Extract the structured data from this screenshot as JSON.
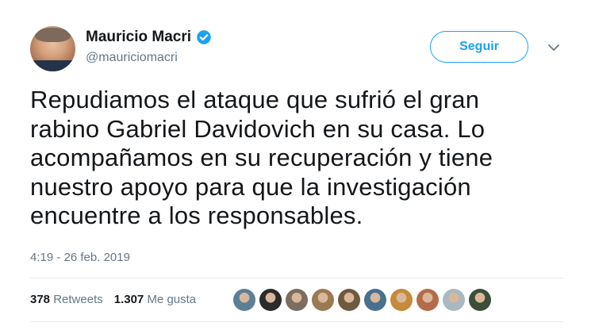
{
  "author": {
    "name": "Mauricio Macri",
    "handle": "@mauriciomacri",
    "verified_icon": "verified-badge-icon"
  },
  "actions": {
    "follow_label": "Seguir",
    "more_icon": "chevron-down-icon"
  },
  "tweet": {
    "lines": [
      "Repudiamos el ataque que sufrió el gran",
      "rabino Gabriel Davidovich en su casa. Lo",
      "acompañamos en su recuperación y tiene",
      "nuestro apoyo para que la investigación",
      "encuentre a los responsables."
    ],
    "timestamp": "4:19 - 26 feb. 2019"
  },
  "stats": {
    "retweets_count": "378",
    "retweets_label": "Retweets",
    "likes_count": "1.307",
    "likes_label": "Me gusta"
  },
  "likers": [
    {
      "color": "#5c7f95"
    },
    {
      "color": "#2b2b2b"
    },
    {
      "color": "#7c6d60"
    },
    {
      "color": "#9a7a52"
    },
    {
      "color": "#6f5a3f"
    },
    {
      "color": "#48708f"
    },
    {
      "color": "#c58a3a"
    },
    {
      "color": "#b56b4a"
    },
    {
      "color": "#aab8c2"
    },
    {
      "color": "#3d4d3a"
    }
  ],
  "colors": {
    "accent": "#1da1f2",
    "text": "#14171a",
    "secondary_text": "#657786",
    "divider": "#e6ecf0"
  }
}
